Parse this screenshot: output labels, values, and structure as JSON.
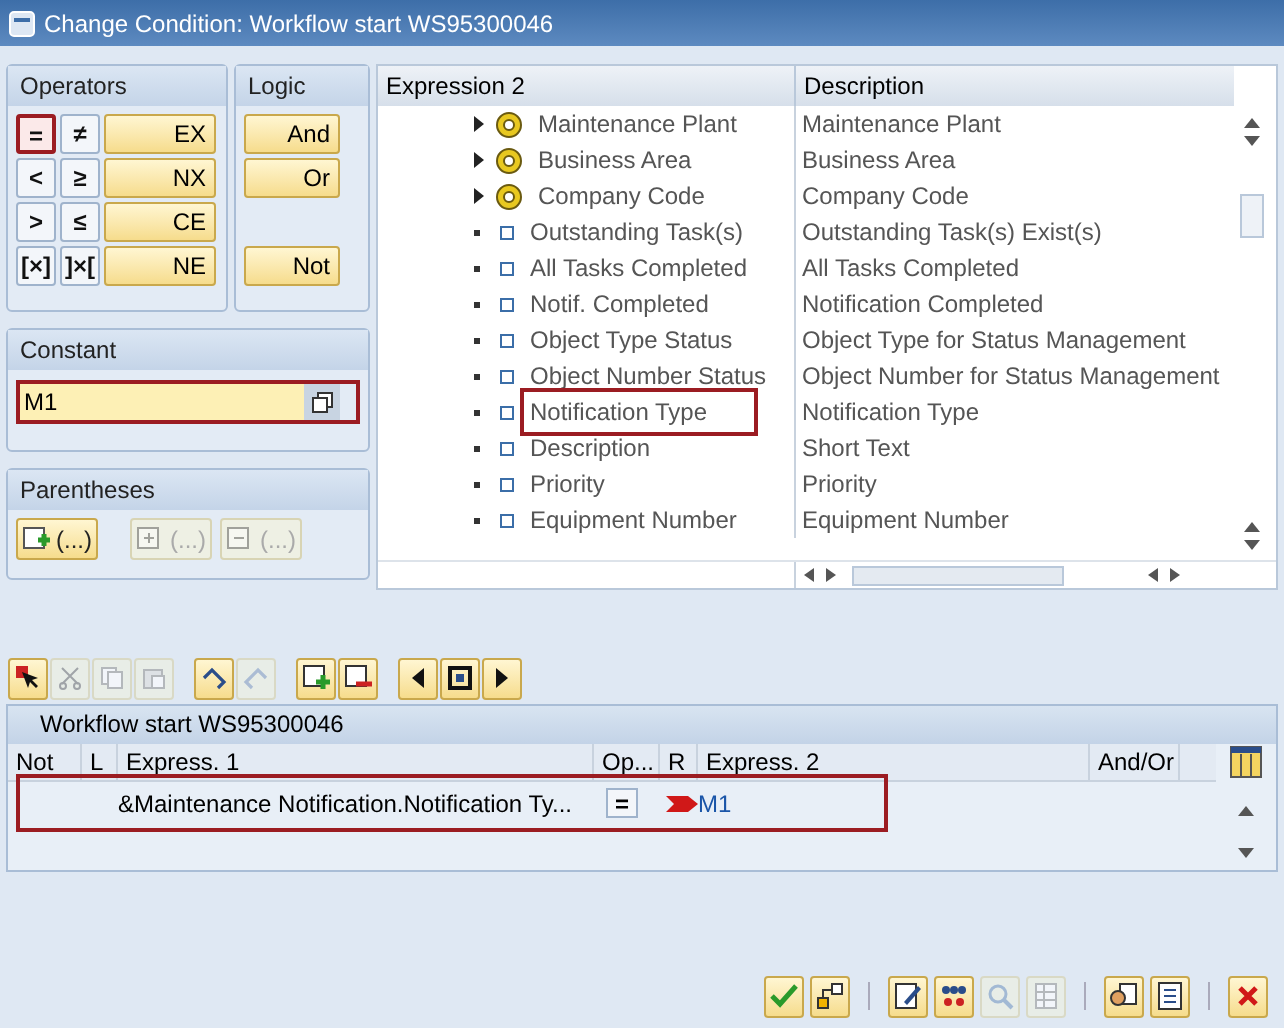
{
  "window": {
    "title": "Change Condition: Workflow start WS95300046"
  },
  "operators": {
    "title": "Operators",
    "buttons": [
      {
        "label": "=",
        "kind": "symbol",
        "highlighted": true
      },
      {
        "label": "≠",
        "kind": "symbol",
        "highlighted": false
      },
      {
        "label": "EX",
        "kind": "text",
        "highlighted": false
      },
      {
        "label": "<",
        "kind": "symbol",
        "highlighted": false
      },
      {
        "label": "≥",
        "kind": "symbol",
        "highlighted": false
      },
      {
        "label": "NX",
        "kind": "text",
        "highlighted": false
      },
      {
        "label": ">",
        "kind": "symbol",
        "highlighted": false
      },
      {
        "label": "≤",
        "kind": "symbol",
        "highlighted": false
      },
      {
        "label": "CE",
        "kind": "text",
        "highlighted": false
      },
      {
        "label": "[×]",
        "kind": "symbol",
        "highlighted": false
      },
      {
        "label": "]×[",
        "kind": "symbol",
        "highlighted": false
      },
      {
        "label": "NE",
        "kind": "text",
        "highlighted": false
      }
    ]
  },
  "logic": {
    "title": "Logic",
    "buttons": [
      {
        "label": "And",
        "kind": "button"
      },
      {
        "label": "Or",
        "kind": "button"
      },
      {
        "kind": "gap"
      },
      {
        "label": "Not",
        "kind": "button"
      }
    ]
  },
  "constant": {
    "title": "Constant",
    "value": "M1",
    "highlighted": true
  },
  "parentheses": {
    "title": "Parentheses",
    "buttons": [
      {
        "label": "(...)",
        "kind": "insert",
        "disabled": false
      },
      {
        "label": "(...)",
        "kind": "add",
        "disabled": true
      },
      {
        "label": "(...)",
        "kind": "remove",
        "disabled": true
      }
    ]
  },
  "tree": {
    "columns": [
      "Expression 2",
      "Description"
    ],
    "rows": [
      {
        "name": "Maintenance Plant",
        "description": "Maintenance Plant",
        "kind": "object",
        "highlighted": false
      },
      {
        "name": "Business Area",
        "description": "Business Area",
        "kind": "object",
        "highlighted": false
      },
      {
        "name": "Company Code",
        "description": "Company Code",
        "kind": "object",
        "highlighted": false
      },
      {
        "name": "Outstanding Task(s)",
        "description": "Outstanding Task(s) Exist(s)",
        "kind": "attribute",
        "highlighted": false
      },
      {
        "name": "All Tasks Completed",
        "description": "All Tasks Completed",
        "kind": "attribute",
        "highlighted": false
      },
      {
        "name": "Notif. Completed",
        "description": "Notification Completed",
        "kind": "attribute",
        "highlighted": false
      },
      {
        "name": "Object Type Status",
        "description": "Object Type for Status Management",
        "kind": "attribute",
        "highlighted": false
      },
      {
        "name": "Object Number Status",
        "description": "Object Number for Status Management",
        "kind": "attribute",
        "highlighted": false
      },
      {
        "name": "Notification Type",
        "description": "Notification Type",
        "kind": "attribute",
        "highlighted": true
      },
      {
        "name": "Description",
        "description": "Short Text",
        "kind": "attribute",
        "highlighted": false
      },
      {
        "name": "Priority",
        "description": "Priority",
        "kind": "attribute",
        "highlighted": false
      },
      {
        "name": "Equipment Number",
        "description": "Equipment Number",
        "kind": "attribute",
        "highlighted": false
      }
    ]
  },
  "conditions": {
    "title": "Workflow start WS95300046",
    "columns": [
      "Not",
      "L",
      "Express. 1",
      "Op...",
      "R",
      "Express. 2",
      "And/Or"
    ],
    "rows": [
      {
        "express_1": "&Maintenance Notification.Notification Ty...",
        "operator": "=",
        "express_2": "M1",
        "highlighted": true
      }
    ]
  }
}
